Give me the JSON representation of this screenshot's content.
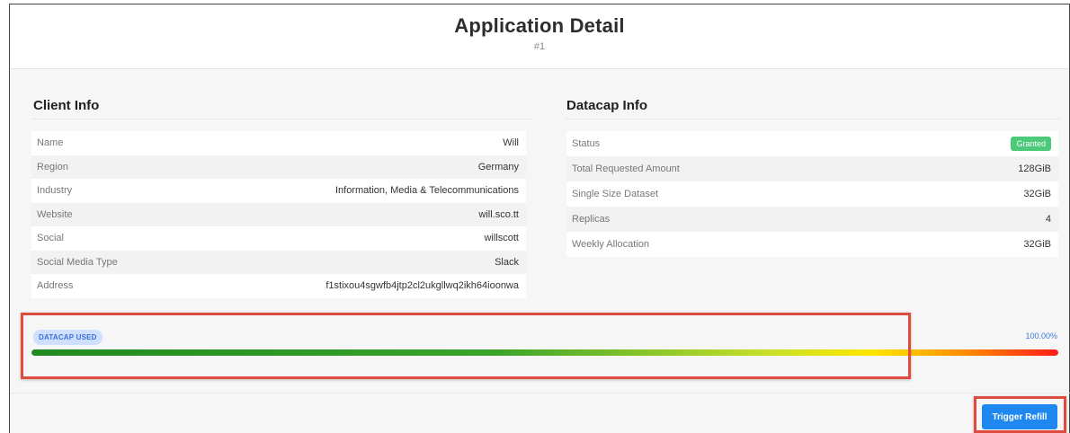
{
  "header": {
    "title": "Application Detail",
    "subtitle": "#1"
  },
  "client_info": {
    "title": "Client Info",
    "rows": [
      {
        "key": "Name",
        "value": "Will"
      },
      {
        "key": "Region",
        "value": "Germany"
      },
      {
        "key": "Industry",
        "value": "Information, Media & Telecommunications"
      },
      {
        "key": "Website",
        "value": "will.sco.tt"
      },
      {
        "key": "Social",
        "value": "willscott"
      },
      {
        "key": "Social Media Type",
        "value": "Slack"
      },
      {
        "key": "Address",
        "value": "f1stixou4sgwfb4jtp2cl2ukgllwq2ikh64ioonwa"
      }
    ]
  },
  "datacap_info": {
    "title": "Datacap Info",
    "status_label": "Status",
    "status_value": "Granted",
    "rows": [
      {
        "key": "Total Requested Amount",
        "value": "128GiB"
      },
      {
        "key": "Single Size Dataset",
        "value": "32GiB"
      },
      {
        "key": "Replicas",
        "value": "4"
      },
      {
        "key": "Weekly Allocation",
        "value": "32GiB"
      }
    ]
  },
  "datacap_used": {
    "label": "DATACAP USED",
    "percent_text": "100.00%",
    "fraction": 1.0
  },
  "actions": {
    "trigger_refill": "Trigger Refill"
  },
  "colors": {
    "granted": "#4cc97a",
    "accent": "#1e88f0",
    "highlight": "#e04b3f"
  }
}
